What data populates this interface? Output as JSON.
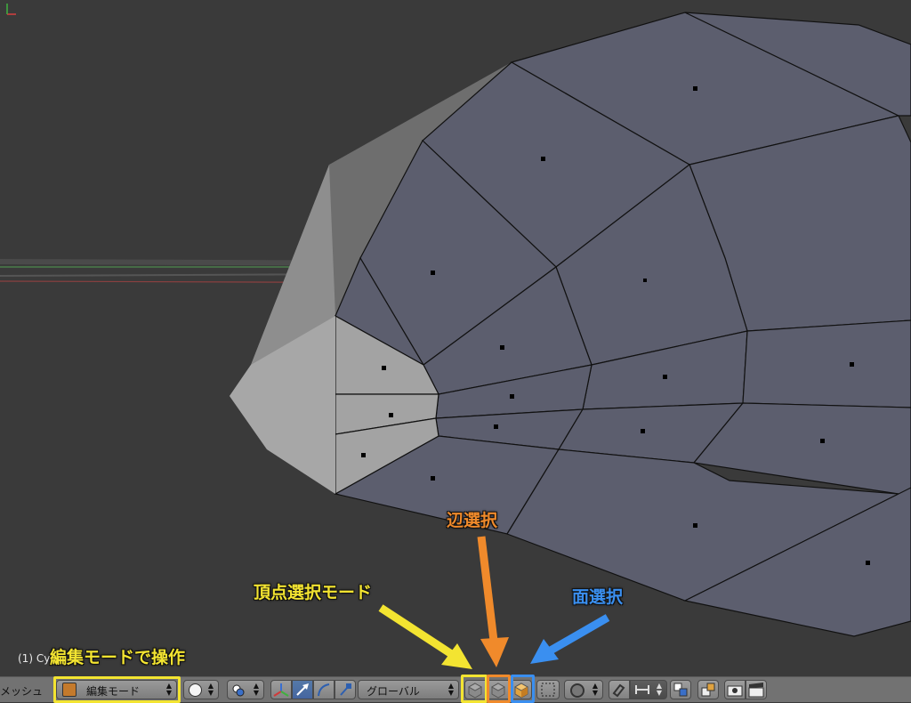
{
  "viewport": {
    "object_info": "(1) Cy",
    "background_color": "#3a3a3a",
    "mesh_face_color": "#5e6070",
    "selected_face_color": "#a0a0a0"
  },
  "annotations": {
    "edit_mode_operation": "編集モードで操作",
    "vertex_select_mode": "頂点選択モード",
    "edge_select": "辺選択",
    "face_select": "面選択",
    "colors": {
      "yellow": "#f3e431",
      "orange": "#f08a2b",
      "blue": "#3a8ff0"
    }
  },
  "header": {
    "menu_label": "メッシュ",
    "mode_select": {
      "value": "編集モード",
      "icon": "edit-mode-icon"
    },
    "viewport_shading": {
      "icon": "solid-sphere-icon"
    },
    "pivot_point": {
      "icon": "pivot-icon"
    },
    "manipulators": [
      {
        "icon": "manipulator-axes-icon",
        "active": false
      },
      {
        "icon": "translate-arrow-icon",
        "active": true
      },
      {
        "icon": "rotate-arc-icon",
        "active": false
      },
      {
        "icon": "scale-icon",
        "active": false
      }
    ],
    "orientation_select": {
      "value": "グローバル"
    },
    "select_modes": [
      {
        "name": "vertex",
        "icon": "vertex-cube-icon",
        "active": false
      },
      {
        "name": "edge",
        "icon": "edge-cube-icon",
        "active": false
      },
      {
        "name": "face",
        "icon": "face-cube-icon",
        "active": true
      }
    ],
    "extra_icons": [
      "occlude-geometry-icon",
      "proportional-edit-icon",
      "snap-magnet-icon",
      "snap-element-icon",
      "snap-target-icon",
      "layer-icon",
      "render-icon",
      "clapper-icon"
    ]
  }
}
